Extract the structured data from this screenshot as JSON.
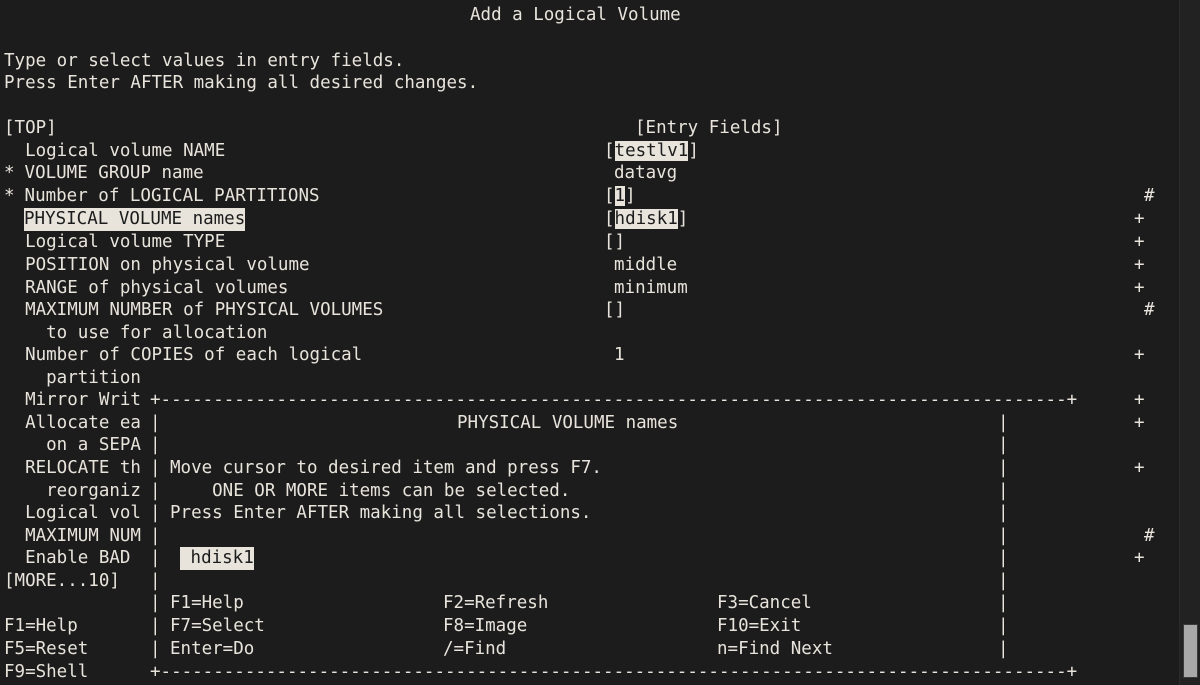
{
  "screen": {
    "title": "Add a Logical Volume",
    "background_color": "#1c1c1c",
    "foreground_color": "#e8e4dc",
    "highlight_bg": "#e8e4dc",
    "highlight_fg": "#1c1c1c"
  },
  "instructions": {
    "line1": "Type or select values in entry fields.",
    "line2": "Press Enter AFTER making all desired changes."
  },
  "form": {
    "top_marker": "[TOP]",
    "entry_fields_header": "[Entry Fields]",
    "more_marker": "[MORE...10]",
    "rows": [
      {
        "required": "",
        "label": "  Logical volume NAME",
        "value_open": "[",
        "value": "testlv1",
        "value_close": "]",
        "value_highlighted": true,
        "suffix": ""
      },
      {
        "required": "*",
        "label": " VOLUME GROUP name",
        "value_open": "",
        "value": "datavg",
        "value_close": "",
        "value_highlighted": false,
        "suffix": ""
      },
      {
        "required": "*",
        "label": " Number of LOGICAL PARTITIONS",
        "value_open": "[",
        "value": "1",
        "value_close": "]",
        "value_highlighted": true,
        "suffix": "#"
      },
      {
        "required": "",
        "label": "  PHYSICAL VOLUME names",
        "label_highlighted": true,
        "value_open": "[",
        "value": "hdisk1",
        "value_close": "]",
        "value_highlighted": true,
        "suffix": "+"
      },
      {
        "required": "",
        "label": "  Logical volume TYPE",
        "value_open": "[",
        "value": "",
        "value_close": "]",
        "value_highlighted": false,
        "suffix": "+"
      },
      {
        "required": "",
        "label": "  POSITION on physical volume",
        "value_open": "",
        "value": "middle",
        "value_close": "",
        "value_highlighted": false,
        "suffix": "+"
      },
      {
        "required": "",
        "label": "  RANGE of physical volumes",
        "value_open": "",
        "value": "minimum",
        "value_close": "",
        "value_highlighted": false,
        "suffix": "+"
      },
      {
        "required": "",
        "label": "  MAXIMUM NUMBER of PHYSICAL VOLUMES",
        "value_open": "[",
        "value": "",
        "value_close": "]",
        "value_highlighted": false,
        "suffix": "#"
      },
      {
        "required": "",
        "label": "    to use for allocation",
        "value_open": "",
        "value": "",
        "value_close": "",
        "value_highlighted": false,
        "suffix": ""
      },
      {
        "required": "",
        "label": "  Number of COPIES of each logical",
        "value_open": "",
        "value": "1",
        "value_close": "",
        "value_highlighted": false,
        "suffix": "+"
      },
      {
        "required": "",
        "label": "    partition",
        "value_open": "",
        "value": "",
        "value_close": "",
        "value_highlighted": false,
        "suffix": ""
      }
    ],
    "occluded_rows": [
      {
        "label": "  Mirror Writ",
        "suffix": "+"
      },
      {
        "label": "  Allocate ea",
        "suffix": "+"
      },
      {
        "label": "    on a SEPA",
        "suffix": ""
      },
      {
        "label": "  RELOCATE th",
        "suffix": "+"
      },
      {
        "label": "    reorganiz",
        "suffix": ""
      },
      {
        "label": "  Logical vol",
        "suffix": ""
      },
      {
        "label": "  MAXIMUM NUM",
        "suffix": "#"
      },
      {
        "label": "  Enable BAD ",
        "suffix": "+"
      }
    ]
  },
  "popup": {
    "title": "PHYSICAL VOLUME names",
    "help_lines": [
      "Move cursor to desired item and press F7.",
      "    ONE OR MORE items can be selected.",
      "Press Enter AFTER making all selections."
    ],
    "items": [
      {
        "label": " hdisk1",
        "selected": true
      }
    ],
    "border_corner": "+",
    "border_h": "-",
    "border_v": "|",
    "keys": [
      {
        "col1": "F1=Help",
        "col2": "F2=Refresh",
        "col3": "F3=Cancel"
      },
      {
        "col1": "F7=Select",
        "col2": "F8=Image",
        "col3": "F10=Exit"
      },
      {
        "col1": "Enter=Do",
        "col2": "/=Find",
        "col3": "n=Find Next"
      }
    ]
  },
  "main_keys": [
    "F1=Help",
    "F5=Reset",
    "F9=Shell"
  ],
  "scrollbar": {
    "thumb_position": "bottom"
  }
}
